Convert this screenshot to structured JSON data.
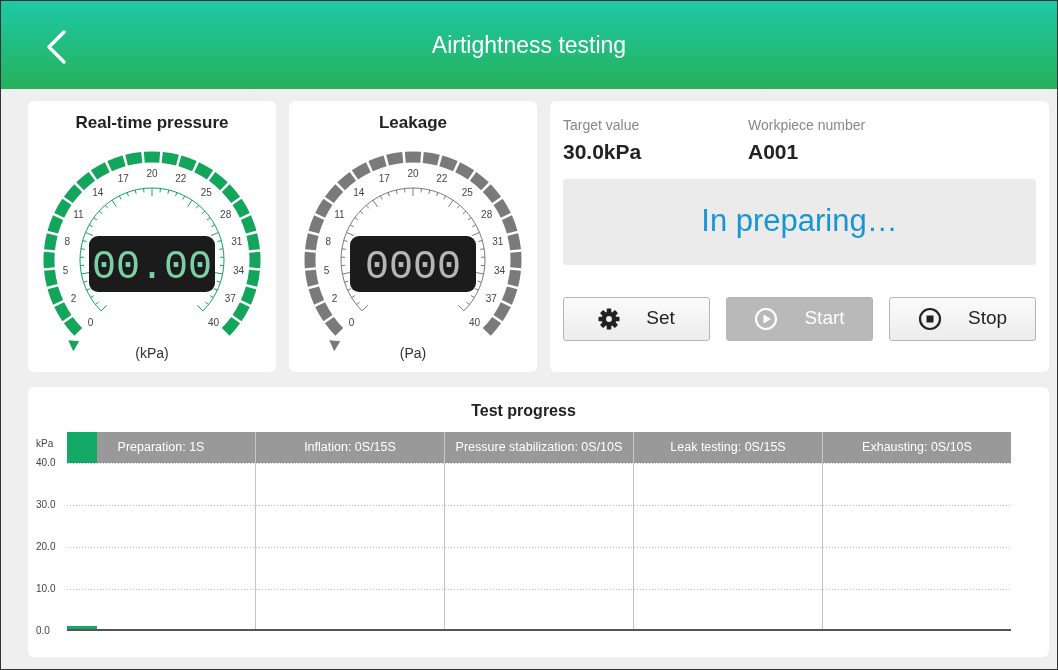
{
  "header": {
    "title": "Airtightness testing"
  },
  "gauges": [
    {
      "title": "Real-time pressure",
      "reading": "00.00",
      "unit": "(kPa)",
      "color": "#13a55c",
      "scale": [
        "0",
        "2",
        "5",
        "8",
        "11",
        "14",
        "17",
        "20",
        "22",
        "25",
        "28",
        "31",
        "34",
        "37",
        "40"
      ]
    },
    {
      "title": "Leakage",
      "reading": "0000",
      "unit": "(Pa)",
      "color": "#7a7a7a",
      "scale": [
        "0",
        "2",
        "5",
        "8",
        "11",
        "14",
        "17",
        "20",
        "22",
        "25",
        "28",
        "31",
        "34",
        "37",
        "40"
      ]
    }
  ],
  "info": {
    "fields": [
      {
        "label": "Target value",
        "value": "30.0kPa"
      },
      {
        "label": "Workpiece number",
        "value": "A001"
      }
    ],
    "status": "In preparing…",
    "buttons": [
      {
        "label": "Set",
        "kind": "gear",
        "disabled": false
      },
      {
        "label": "Start",
        "kind": "play",
        "disabled": true
      },
      {
        "label": "Stop",
        "kind": "stop",
        "disabled": false
      }
    ]
  },
  "progress": {
    "title": "Test progress",
    "y_unit": "kPa",
    "y_ticks": [
      "40.0",
      "30.0",
      "20.0",
      "10.0",
      "0.0"
    ],
    "stages": [
      {
        "label": "Preparation: 1S",
        "level": 0.16
      },
      {
        "label": "Inflation: 0S/15S"
      },
      {
        "label": "Pressure stabilization: 0S/10S"
      },
      {
        "label": "Leak testing: 0S/15S"
      },
      {
        "label": "Exhausting: 0S/10S"
      }
    ]
  }
}
